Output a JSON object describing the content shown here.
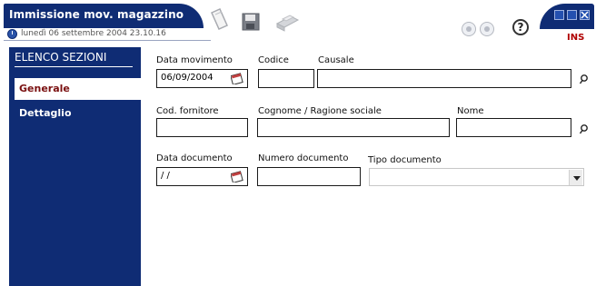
{
  "window": {
    "title": "Immissione mov. magazzino",
    "datetime": "lunedì 06 settembre 2004  23.10.16",
    "mode": "INS"
  },
  "sidebar": {
    "title": "ELENCO SEZIONI",
    "items": [
      {
        "label": "Generale",
        "active": true
      },
      {
        "label": "Dettaglio",
        "active": false
      }
    ]
  },
  "form": {
    "data_movimento": {
      "label": "Data movimento",
      "value": "06/09/2004"
    },
    "codice": {
      "label": "Codice",
      "value": ""
    },
    "causale": {
      "label": "Causale",
      "value": ""
    },
    "cod_fornitore": {
      "label": "Cod. fornitore",
      "value": ""
    },
    "cognome": {
      "label": "Cognome / Ragione sociale",
      "value": ""
    },
    "nome": {
      "label": "Nome",
      "value": ""
    },
    "data_documento": {
      "label": "Data documento",
      "value": "/ /"
    },
    "numero_documento": {
      "label": "Numero documento",
      "value": ""
    },
    "tipo_documento": {
      "label": "Tipo documento",
      "value": ""
    }
  },
  "icons": {
    "clock": "clock-icon",
    "pages": "pages-icon",
    "save": "save-icon",
    "print": "print-icon",
    "prev": "prev-icon",
    "next": "next-icon",
    "help": "help-icon",
    "help_glyph": "?",
    "calendar": "calendar-icon",
    "lookup": "lookup-icon"
  },
  "colors": {
    "brand_navy": "#0f2c74",
    "active_text": "#7a1010",
    "mode_text": "#b00000"
  }
}
